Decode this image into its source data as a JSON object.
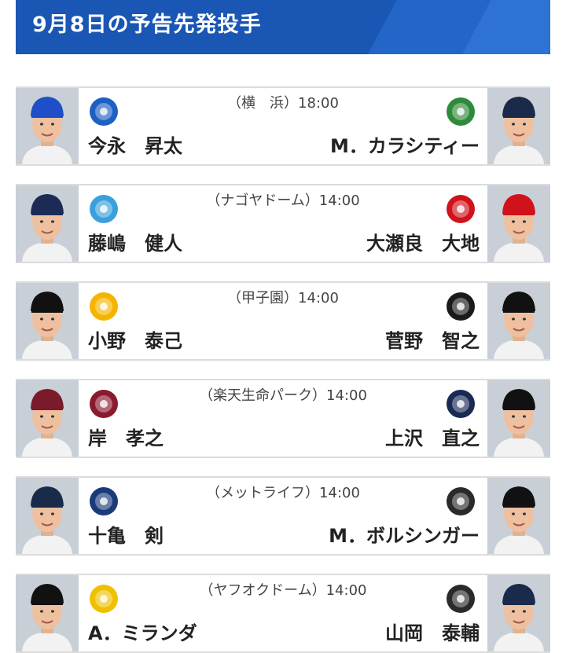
{
  "header": {
    "title": "9月8日の予告先発投手"
  },
  "games": [
    {
      "venue": "（横　浜）18:00",
      "home_pitcher": "今永　昇太",
      "away_pitcher": "M．カラシティー",
      "home_team_icon": "baystars-logo-icon",
      "away_team_icon": "swallows-logo-icon",
      "colors": {
        "home_cap": "#1e4fc8",
        "away_cap": "#1a2a4a",
        "home_logo": "#1d5fc4",
        "away_logo": "#2e8b3a"
      }
    },
    {
      "venue": "（ナゴヤドーム）14:00",
      "home_pitcher": "藤嶋　健人",
      "away_pitcher": "大瀬良　大地",
      "home_team_icon": "dragons-logo-icon",
      "away_team_icon": "carp-logo-icon",
      "colors": {
        "home_cap": "#1b2b55",
        "away_cap": "#d0121b",
        "home_logo": "#3aa0dc",
        "away_logo": "#d0121b"
      }
    },
    {
      "venue": "（甲子園）14:00",
      "home_pitcher": "小野　泰己",
      "away_pitcher": "菅野　智之",
      "home_team_icon": "tigers-logo-icon",
      "away_team_icon": "giants-logo-icon",
      "colors": {
        "home_cap": "#111111",
        "away_cap": "#111111",
        "home_logo": "#f5b400",
        "away_logo": "#1a1a1a"
      }
    },
    {
      "venue": "（楽天生命パーク）14:00",
      "home_pitcher": "岸　孝之",
      "away_pitcher": "上沢　直之",
      "home_team_icon": "eagles-logo-icon",
      "away_team_icon": "fighters-logo-icon",
      "colors": {
        "home_cap": "#7a1a2a",
        "away_cap": "#111111",
        "home_logo": "#8a1a2e",
        "away_logo": "#1a2a55"
      }
    },
    {
      "venue": "（メットライフ）14:00",
      "home_pitcher": "十亀　剣",
      "away_pitcher": "M．ボルシンガー",
      "home_team_icon": "lions-logo-icon",
      "away_team_icon": "marines-logo-icon",
      "colors": {
        "home_cap": "#1a2a4a",
        "away_cap": "#111111",
        "home_logo": "#1a3a7a",
        "away_logo": "#2a2a2a"
      }
    },
    {
      "venue": "（ヤフオクドーム）14:00",
      "home_pitcher": "A．ミランダ",
      "away_pitcher": "山岡　泰輔",
      "home_team_icon": "hawks-logo-icon",
      "away_team_icon": "buffaloes-logo-icon",
      "colors": {
        "home_cap": "#111111",
        "away_cap": "#1a2a4a",
        "home_logo": "#f0c000",
        "away_logo": "#2a2a2a"
      }
    }
  ]
}
